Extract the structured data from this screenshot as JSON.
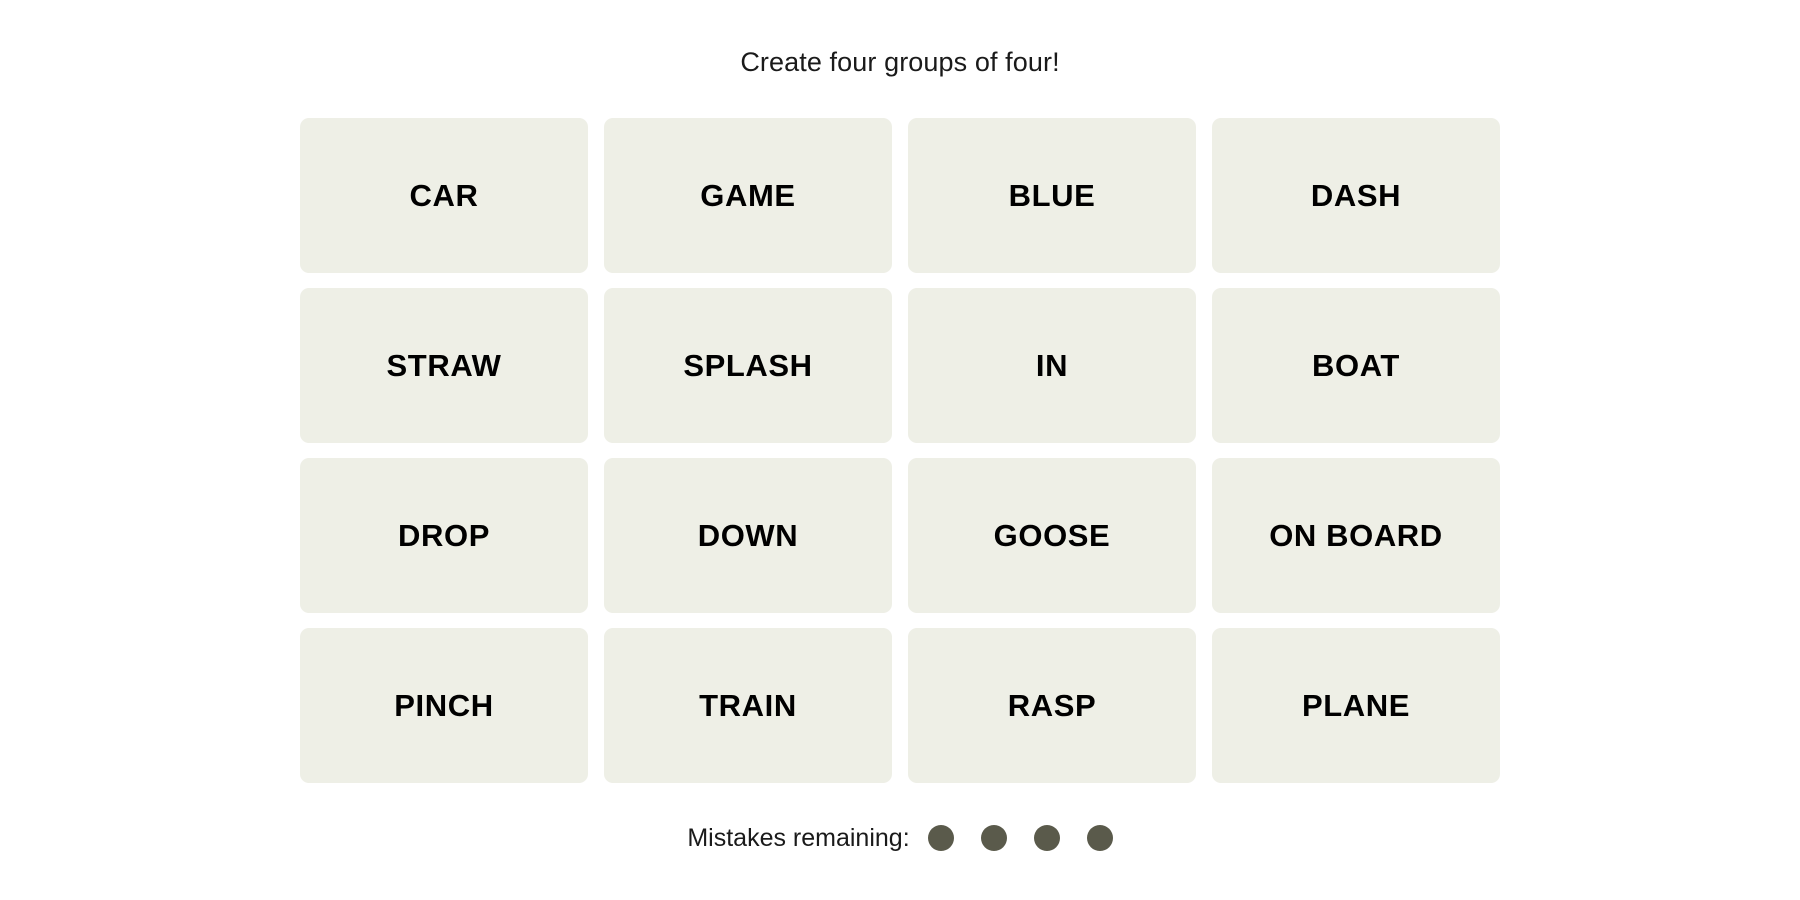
{
  "header": {
    "title": "Create four groups of four!"
  },
  "board": {
    "rows": 4,
    "columns": 4,
    "tile_background": "#eeefe6",
    "tile_text_color": "#000000",
    "tiles": [
      {
        "label": "CAR"
      },
      {
        "label": "GAME"
      },
      {
        "label": "BLUE"
      },
      {
        "label": "DASH"
      },
      {
        "label": "STRAW"
      },
      {
        "label": "SPLASH"
      },
      {
        "label": "IN"
      },
      {
        "label": "BOAT"
      },
      {
        "label": "DROP"
      },
      {
        "label": "DOWN"
      },
      {
        "label": "GOOSE"
      },
      {
        "label": "ON BOARD"
      },
      {
        "label": "PINCH"
      },
      {
        "label": "TRAIN"
      },
      {
        "label": "RASP"
      },
      {
        "label": "PLANE"
      }
    ]
  },
  "mistakes": {
    "label": "Mistakes remaining:",
    "remaining": 4,
    "dot_color": "#5a5a4b",
    "dots": [
      {
        "state": "filled"
      },
      {
        "state": "filled"
      },
      {
        "state": "filled"
      },
      {
        "state": "filled"
      }
    ]
  }
}
